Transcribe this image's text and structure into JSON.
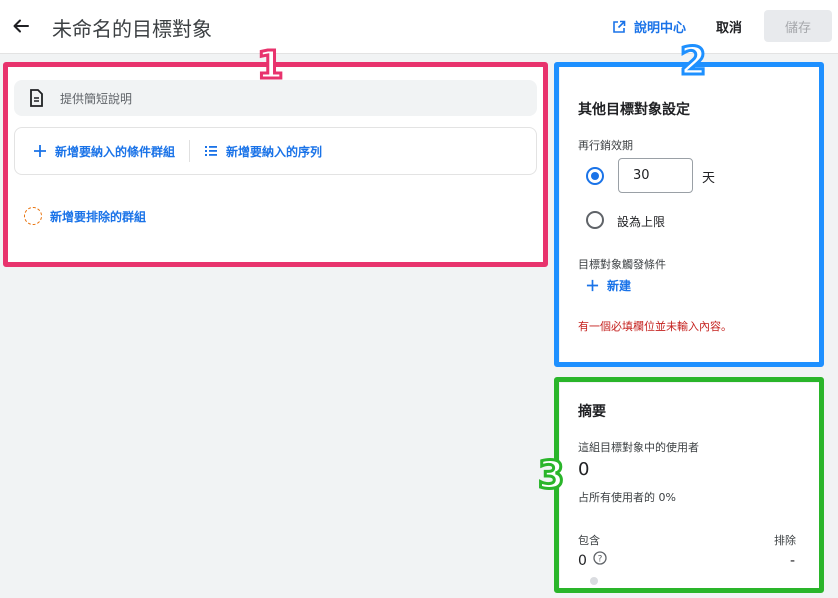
{
  "header": {
    "title": "未命名的目標對象",
    "help_label": "說明中心",
    "cancel_label": "取消",
    "save_label": "儲存"
  },
  "left": {
    "description_placeholder": "提供簡短說明",
    "include_group_label": "新增要納入的條件群組",
    "include_sequence_label": "新增要納入的序列",
    "exclude_group_label": "新增要排除的群組"
  },
  "settings": {
    "title": "其他目標對象設定",
    "membership_label": "再行銷效期",
    "duration_value": "30",
    "duration_unit": "天",
    "max_limit_label": "設為上限",
    "trigger_label": "目標對象觸發條件",
    "new_label": "新建",
    "error_text": "有一個必填欄位並未輸入內容。"
  },
  "summary": {
    "title": "摘要",
    "users_label": "這組目標對象中的使用者",
    "users_value": "0",
    "percent_text": "占所有使用者的 0%",
    "include_label": "包含",
    "exclude_label": "排除",
    "include_value": "0",
    "exclude_value": "-"
  },
  "annotations": {
    "n1": "1",
    "n2": "2",
    "n3": "3"
  },
  "colors": {
    "accent": "#1a73e8",
    "error": "#c5221f",
    "annotation_1": "#e8336d",
    "annotation_2": "#1e90ff",
    "annotation_3": "#2ab52a"
  }
}
